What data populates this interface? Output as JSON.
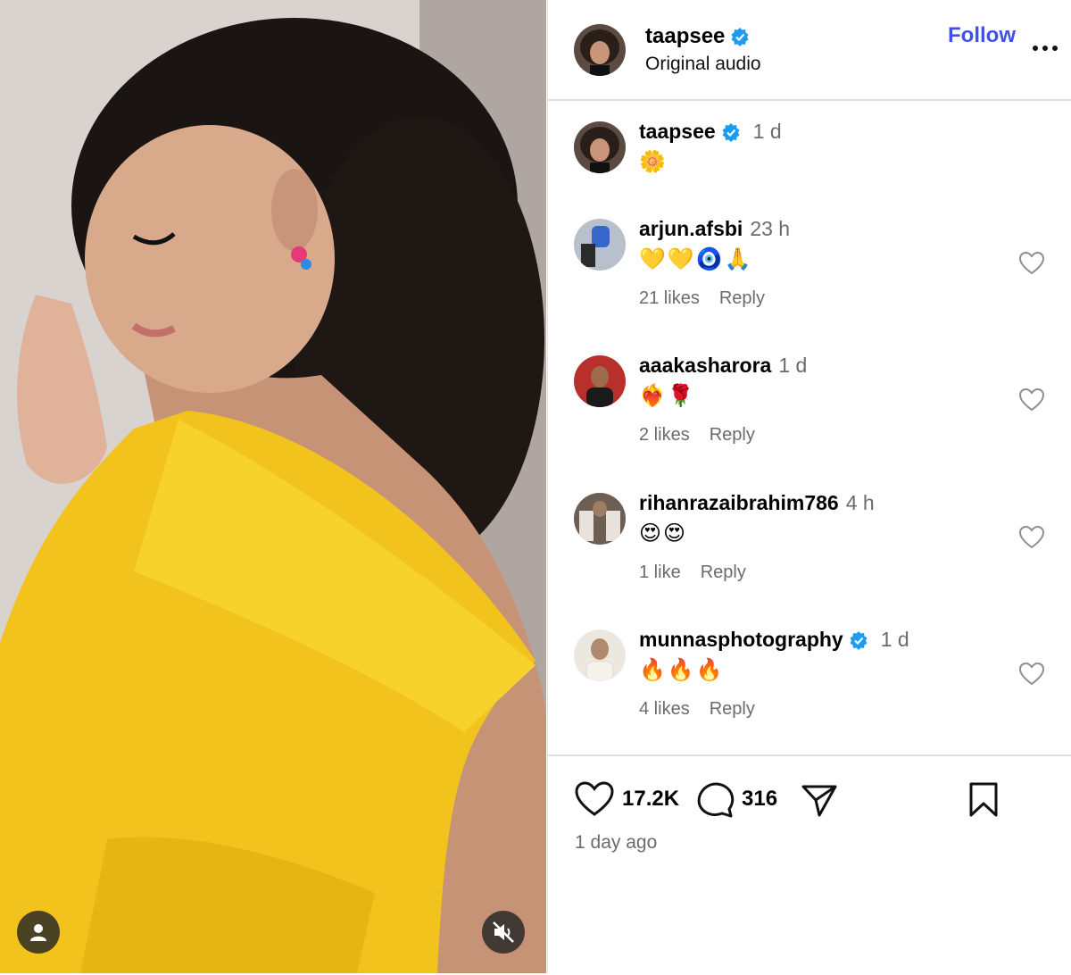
{
  "post": {
    "author": "taapsee",
    "audio": "Original audio",
    "follow_label": "Follow",
    "media": {
      "tag_icon": "user-tag-icon",
      "mute_icon": "speaker-muted-icon"
    }
  },
  "caption": {
    "username": "taapsee",
    "time": "1 d",
    "text": "🌼"
  },
  "comments": [
    {
      "username": "arjun.afsbi",
      "time": "23 h",
      "text": "💛💛🧿🙏",
      "likes": "21 likes",
      "reply": "Reply",
      "verified": false
    },
    {
      "username": "aaakasharora",
      "time": "1 d",
      "text": "❤️‍🔥🌹",
      "likes": "2 likes",
      "reply": "Reply",
      "verified": false
    },
    {
      "username": "rihanrazaibrahim786",
      "time": "4 h",
      "text": "😍😍",
      "likes": "1 like",
      "reply": "Reply",
      "verified": false
    },
    {
      "username": "munnasphotography",
      "time": "1 d",
      "text": "🔥🔥🔥",
      "likes": "4 likes",
      "reply": "Reply",
      "verified": true
    }
  ],
  "actions": {
    "likes": "17.2K",
    "comments": "316",
    "date": "1 day ago"
  },
  "colors": {
    "accent": "#3f51e8",
    "verified": "#1d9bf0",
    "muted_text": "#6b6b6b"
  }
}
